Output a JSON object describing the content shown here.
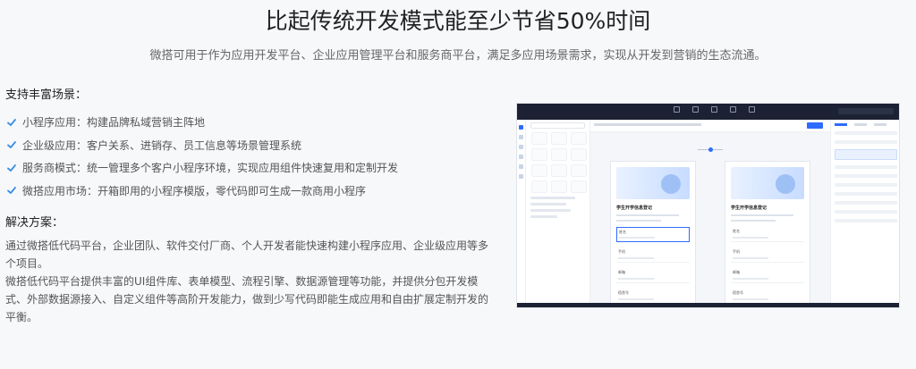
{
  "header": {
    "title": "比起传统开发模式能至少节省50%时间",
    "subtitle": "微搭可用于作为应用开发平台、企业应用管理平台和服务商平台，满足多应用场景需求，实现从开发到营销的生态流通。"
  },
  "scenarios": {
    "title": "支持丰富场景：",
    "items": [
      {
        "label": "小程序应用：构建品牌私域营销主阵地"
      },
      {
        "label": "企业级应用：客户关系、进销存、员工信息等场景管理系统"
      },
      {
        "label": "服务商模式：统一管理多个客户小程序环境，实现应用组件快速复用和定制开发"
      },
      {
        "label": "微搭应用市场：开箱即用的小程序模版，零代码即可生成一款商用小程序"
      }
    ]
  },
  "solution": {
    "title": "解决方案：",
    "p1": "通过微搭低代码平台，企业团队、软件交付厂商、个人开发者能快速构建小程序应用、企业级应用等多个项目。",
    "p2": "微搭低代码平台提供丰富的UI组件库、表单模型、流程引擎、数据源管理等功能，并提供分包开发模式、外部数据源接入、自定义组件等高阶开发能力，做到少写代码即能生成应用和自由扩展定制开发的平衡。"
  },
  "screenshot": {
    "page_title": "学生开学信息登记",
    "field_name": "姓名",
    "field_phone": "手机",
    "field_email": "邮箱",
    "field_dorm": "宿舍号"
  },
  "colors": {
    "accent": "#2f6bff",
    "check": "#3a8ee6",
    "topbar": "#1c2233"
  },
  "icons": {
    "check": "check-icon"
  }
}
